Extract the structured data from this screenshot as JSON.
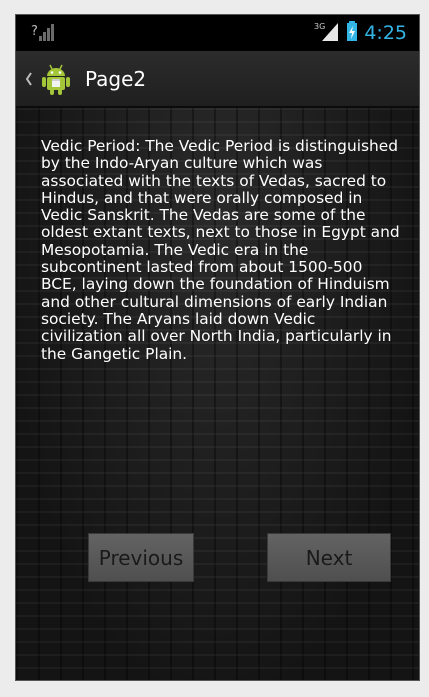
{
  "status_bar": {
    "left_icon": "no-signal-icon",
    "network_type": "3G",
    "time": "4:25"
  },
  "action_bar": {
    "title": "Page2",
    "up_icon": "chevron-left-icon",
    "app_icon": "android-robot-icon"
  },
  "content": {
    "text": "Vedic Period: The Vedic Period is distinguished by the Indo-Aryan culture which was associated with the texts of Vedas, sacred to Hindus, and that were orally composed in Vedic Sanskrit. The Vedas are some of the oldest extant texts, next to those in Egypt and Mesopotamia. The Vedic era in the subcontinent lasted from about 1500-500 BCE, laying down the foundation of Hinduism and other cultural dimensions of early Indian society. The Aryans laid down Vedic civilization all over North India, particularly in the Gangetic Plain."
  },
  "buttons": {
    "previous": "Previous",
    "next": "Next"
  },
  "colors": {
    "status_accent": "#33b5e5",
    "android_green": "#a4c639"
  }
}
